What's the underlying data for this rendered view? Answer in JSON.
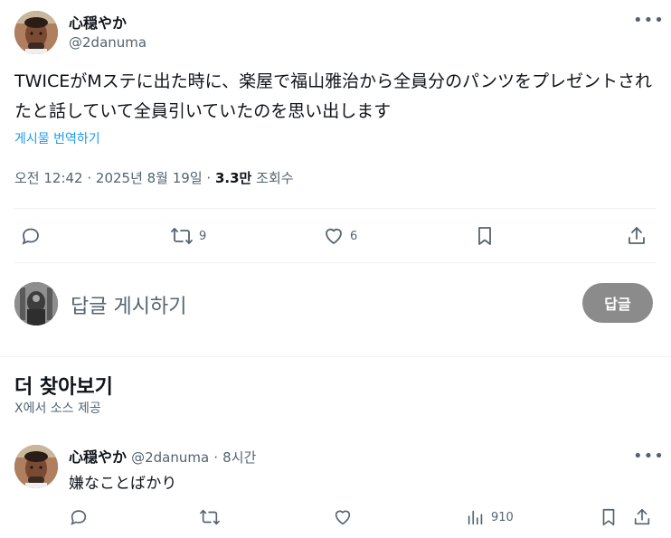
{
  "tweet": {
    "author_name": "心穏やか",
    "author_handle": "@2danuma",
    "text": "TWICEがMステに出た時に、楽屋で福山雅治から全員分のパンツをプレゼントされたと話していて全員引いていたのを思い出します",
    "translate_label": "게시물 번역하기",
    "timestamp": "오전 12:42 · 2025년 8월 19일",
    "separator": "·",
    "views_count": "3.3만",
    "views_label": "조회수",
    "more_icon": "more-icon"
  },
  "actions": {
    "reply_icon": "reply-icon",
    "retweet_icon": "retweet-icon",
    "retweet_count": "9",
    "like_icon": "like-icon",
    "like_count": "6",
    "bookmark_icon": "bookmark-icon",
    "share_icon": "share-icon"
  },
  "composer": {
    "placeholder": "답글 게시하기",
    "button_label": "답글"
  },
  "more_section": {
    "title": "더 찾아보기",
    "subtitle": "X에서 소스 제공"
  },
  "reply_tweet": {
    "author_name": "心穏やか",
    "author_handle": "@2danuma",
    "separator": "·",
    "time": "8시간",
    "text": "嫌なことばかり",
    "views_count": "910"
  },
  "colors": {
    "accent": "#1d9bf0",
    "text": "#0f1419",
    "muted": "#536471",
    "divider": "#eff3f4",
    "button_disabled": "#8b8b8b"
  }
}
